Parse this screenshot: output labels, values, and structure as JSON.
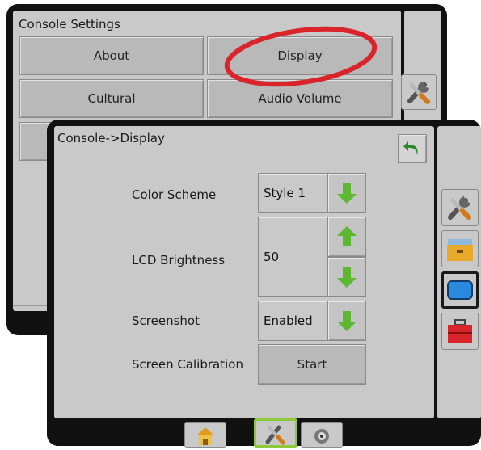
{
  "back_screen": {
    "title": "Console Settings",
    "buttons": {
      "about": "About",
      "display": "Display",
      "cultural": "Cultural",
      "audio_volume": "Audio Volume"
    },
    "side_icons": [
      "wrench-screwdriver-icon"
    ]
  },
  "front_screen": {
    "title": "Console->Display",
    "back_icon": "back-arrow-icon",
    "settings": {
      "color_scheme": {
        "label": "Color Scheme",
        "value": "Style 1"
      },
      "lcd_brightness": {
        "label": "LCD Brightness",
        "value": "50"
      },
      "screenshot": {
        "label": "Screenshot",
        "value": "Enabled"
      },
      "screen_calibration": {
        "label": "Screen Calibration",
        "button": "Start"
      }
    },
    "side_icons": [
      "wrench-screwdriver-icon",
      "folder-icon",
      "display-icon",
      "toolbox-icon"
    ],
    "bottom_tabs": [
      "home-icon",
      "tools-icon",
      "camera-icon"
    ]
  },
  "colors": {
    "highlight_circle": "#d8242a",
    "arrow_green": "#5cb82e",
    "selected_tab_border": "#8fc93a"
  }
}
